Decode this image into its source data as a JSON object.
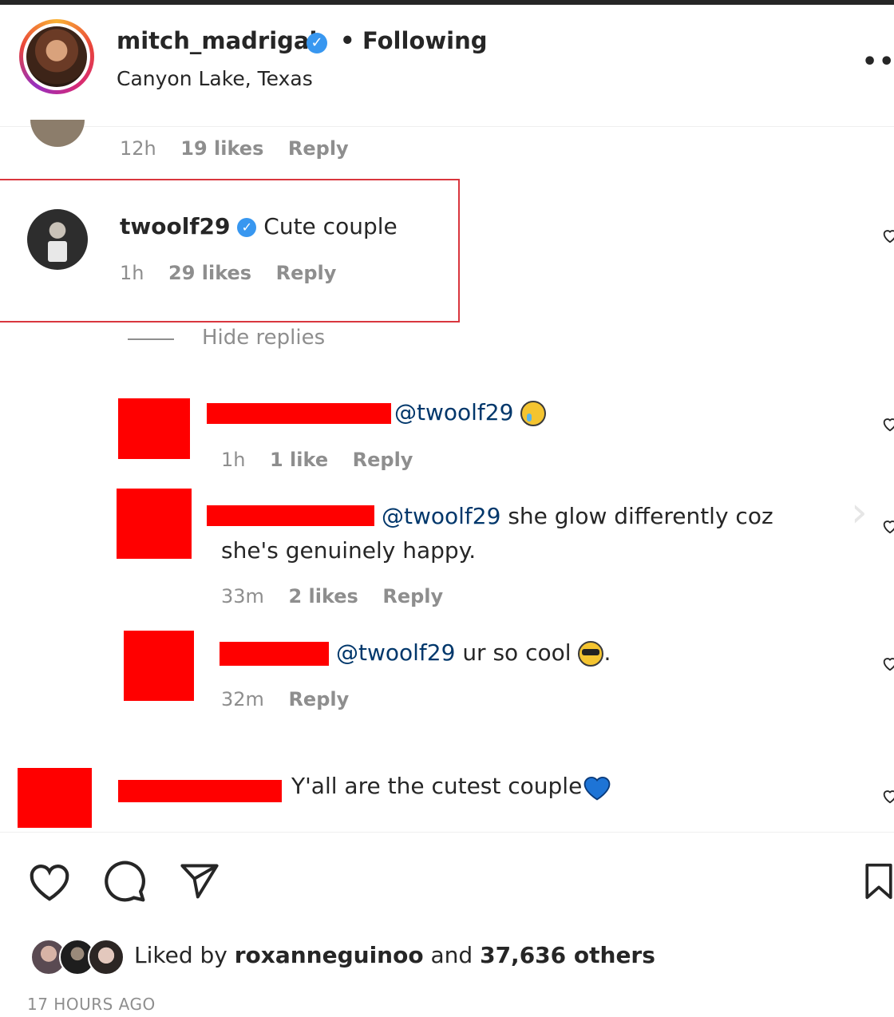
{
  "post_header": {
    "username": "mitch_madrigal",
    "verified": true,
    "separator": "•",
    "follow_status": "Following",
    "location": "Canyon Lake, Texas",
    "more_label": "•••"
  },
  "comments": [
    {
      "time": "12h",
      "likes": "19 likes",
      "reply_label": "Reply"
    },
    {
      "username": "twoolf29",
      "verified": true,
      "text": "Cute couple",
      "time": "1h",
      "likes": "29 likes",
      "reply_label": "Reply",
      "highlighted": true
    }
  ],
  "replies_toggle": "Hide replies",
  "replies": [
    {
      "mention": "@twoolf29",
      "text": "",
      "emoji": "crying-face",
      "time": "1h",
      "likes": "1 like",
      "reply_label": "Reply"
    },
    {
      "mention": "@twoolf29",
      "text_line1": "she glow differently coz",
      "text_line2": "she's genuinely happy.",
      "time": "33m",
      "likes": "2 likes",
      "reply_label": "Reply"
    },
    {
      "mention": "@twoolf29",
      "text": "ur so cool",
      "emoji": "sunglasses-face",
      "suffix": ".",
      "time": "32m",
      "reply_label": "Reply"
    }
  ],
  "last_comment": {
    "text": "Y'all are the cutest couple",
    "emoji": "blue-heart"
  },
  "likes_summary": {
    "prefix": "Liked by",
    "user": "roxanneguinoo",
    "middle": "and",
    "count": "37,636 others"
  },
  "timestamp": "17 HOURS AGO",
  "colors": {
    "redaction": "#ff0000",
    "highlight_border": "#d9363e",
    "mention": "#00376b",
    "verified": "#3897f0",
    "muted": "#8e8e8e"
  }
}
